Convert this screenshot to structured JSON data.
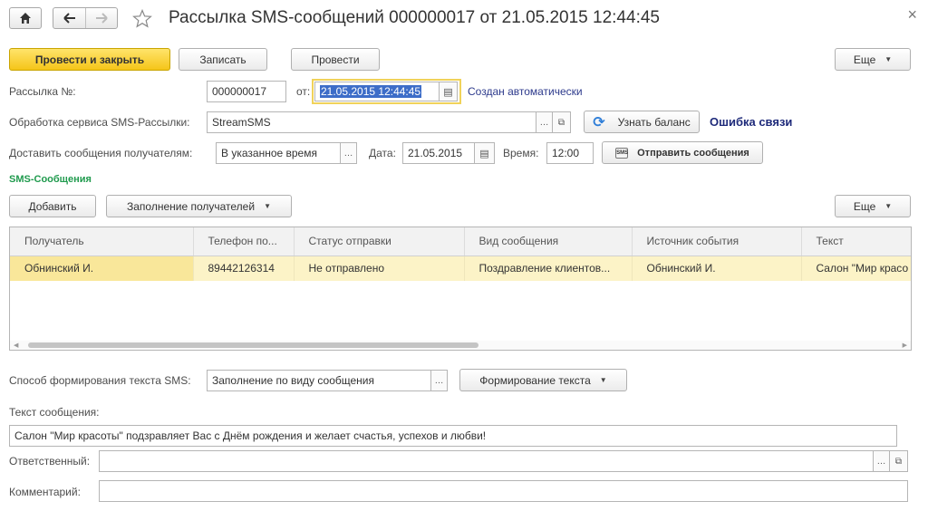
{
  "window": {
    "title": "Рассылка SMS-сообщений 000000017 от 21.05.2015 12:44:45",
    "home_icon": "home-icon",
    "back_icon": "arrow-left-icon",
    "forward_icon": "arrow-right-icon",
    "favorite_icon": "star-icon",
    "close_glyph": "×"
  },
  "toolbar": {
    "post_close": "Провести и закрыть",
    "save": "Записать",
    "post": "Провести",
    "more": "Еще"
  },
  "header": {
    "number_label": "Рассылка №:",
    "number_value": "000000017",
    "date_label": "от:",
    "date_value": "21.05.2015 12:44:45",
    "auto_created": "Создан автоматически",
    "service_label": "Обработка сервиса SMS-Рассылки:",
    "service_value": "StreamSMS",
    "balance_button": "Узнать баланс",
    "connection_error": "Ошибка связи",
    "deliver_label": "Доставить сообщения получателям:",
    "deliver_value": "В указанное время",
    "send_date_label": "Дата:",
    "send_date_value": "21.05.2015",
    "time_label": "Время:",
    "time_value": "12:00",
    "send_button": "Отправить сообщения"
  },
  "messages": {
    "section_title": "SMS-Сообщения",
    "add_button": "Добавить",
    "fill_button": "Заполнение получателей",
    "more": "Еще",
    "columns": [
      "Получатель",
      "Телефон по...",
      "Статус отправки",
      "Вид сообщения",
      "Источник события",
      "Текст"
    ],
    "rows": [
      [
        "Обнинский И.",
        "89442126314",
        "Не отправлено",
        "Поздравление клиентов...",
        "Обнинский И.",
        "Салон \"Мир красо"
      ]
    ]
  },
  "footer": {
    "method_label": "Способ формирования текста SMS:",
    "method_value": "Заполнение по виду сообщения",
    "form_text_button": "Формирование текста",
    "text_label": "Текст сообщения:",
    "text_value": "Салон \"Мир красоты\" подзравляет Вас с Днём рождения и желает счастья, успехов и любви!",
    "responsible_label": "Ответственный:",
    "responsible_value": "",
    "comment_label": "Комментарий:",
    "comment_value": ""
  },
  "colors": {
    "accent_yellow": "#f5c519",
    "link": "#2d3a8c",
    "section_green": "#1f9a4d",
    "row_selected": "#fcf3c7"
  }
}
